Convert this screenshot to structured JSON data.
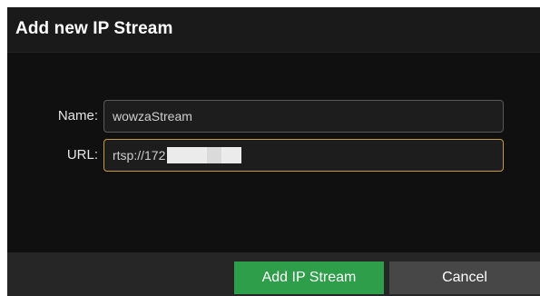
{
  "dialog": {
    "title": "Add new IP Stream"
  },
  "form": {
    "name": {
      "label": "Name:",
      "value": "wowzaStream"
    },
    "url": {
      "label": "URL:",
      "value": "rtsp://172"
    }
  },
  "actions": {
    "primary_label": "Add IP Stream",
    "secondary_label": "Cancel"
  },
  "colors": {
    "dialog_background": "#101010",
    "title_bar": "#1a1a1a",
    "footer": "#262626",
    "primary_button": "#2e9e4a",
    "secondary_button": "#474747",
    "focus_border": "#c89a3a",
    "input_border": "#5a5a5a"
  }
}
